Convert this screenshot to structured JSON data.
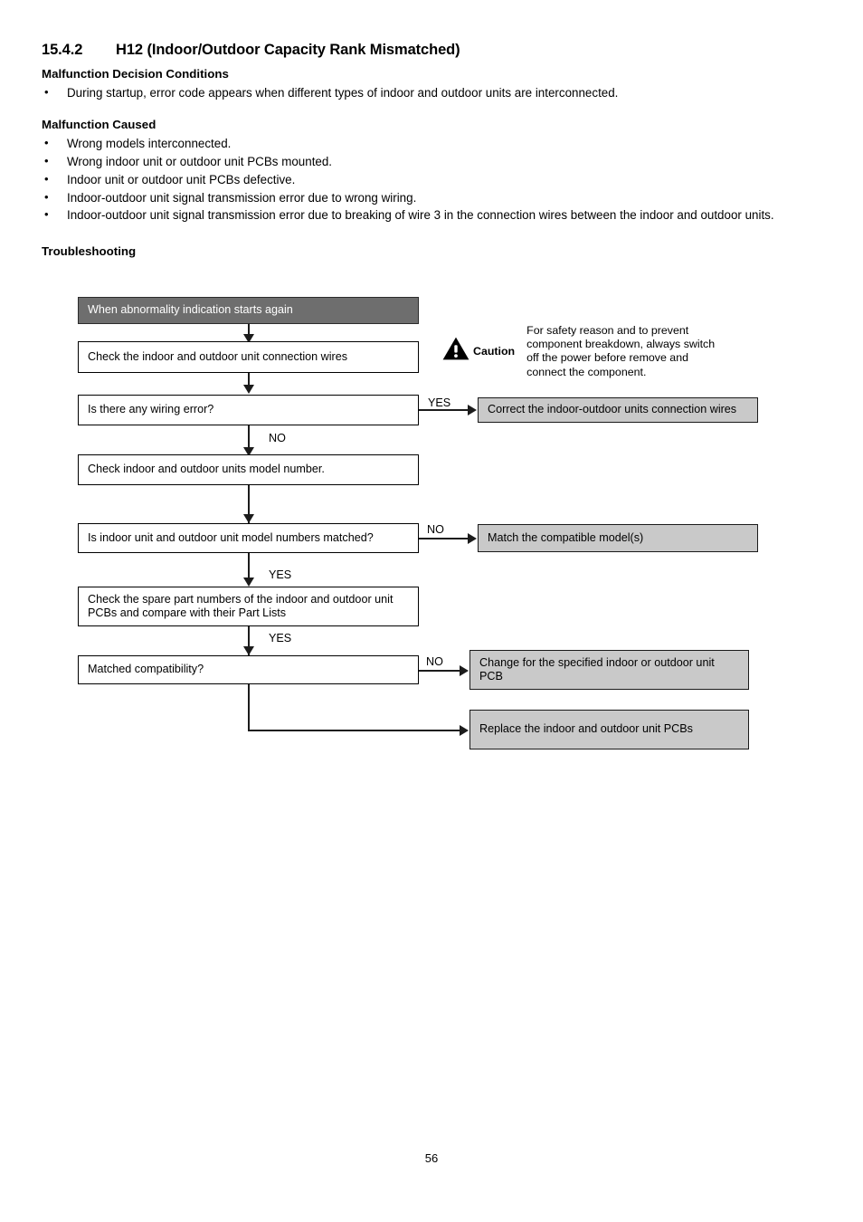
{
  "document": {
    "section_number": "15.4.2",
    "section_title": "H12 (Indoor/Outdoor Capacity Rank Mismatched)",
    "decision_conditions_heading": "Malfunction Decision Conditions",
    "decision_conditions": [
      "During startup, error code appears when different types of indoor and outdoor units are interconnected."
    ],
    "malfunction_caused_heading": "Malfunction Caused",
    "malfunction_caused": [
      "Wrong models interconnected.",
      "Wrong indoor unit or outdoor unit PCBs mounted.",
      "Indoor unit or outdoor unit PCBs defective.",
      "Indoor-outdoor unit signal transmission error due to wrong wiring.",
      "Indoor-outdoor unit signal transmission error due to breaking of wire 3 in the connection wires between the indoor and outdoor units."
    ],
    "troubleshooting_heading": "Troubleshooting",
    "page_number": "56"
  },
  "caution": {
    "icon": "warning-triangle-icon",
    "label": "Caution",
    "text": "For safety reason and to prevent component breakdown, always switch off the power before remove and connect the component."
  },
  "flowchart": {
    "nodes": {
      "start": "When abnormality indication starts again",
      "check_wires": "Check the indoor and outdoor unit connection wires",
      "wiring_error": "Is there any wiring error?",
      "correct_wires": "Correct the indoor-outdoor units connection wires",
      "check_model": "Check indoor and outdoor units model number.",
      "model_matched": "Is indoor unit and outdoor unit model numbers matched?",
      "match_model": "Match the compatible model(s)",
      "check_spare": "Check the spare part numbers of the indoor and outdoor unit PCBs and compare with their Part Lists",
      "matched_compat": "Matched compatibility?",
      "change_pcb": "Change for the specified indoor or outdoor unit PCB",
      "replace_pcb": "Replace the indoor and outdoor unit PCBs"
    },
    "labels": {
      "yes_wiring": "YES",
      "no_wiring": "NO",
      "no_model": "NO",
      "yes_model": "YES",
      "yes_spare": "YES",
      "no_compat": "NO"
    },
    "colors": {
      "start_fill": "#6e6e6e",
      "action_fill": "#c9c9c9",
      "decision_fill": "#ffffff",
      "line": "#1c1c1c"
    }
  }
}
